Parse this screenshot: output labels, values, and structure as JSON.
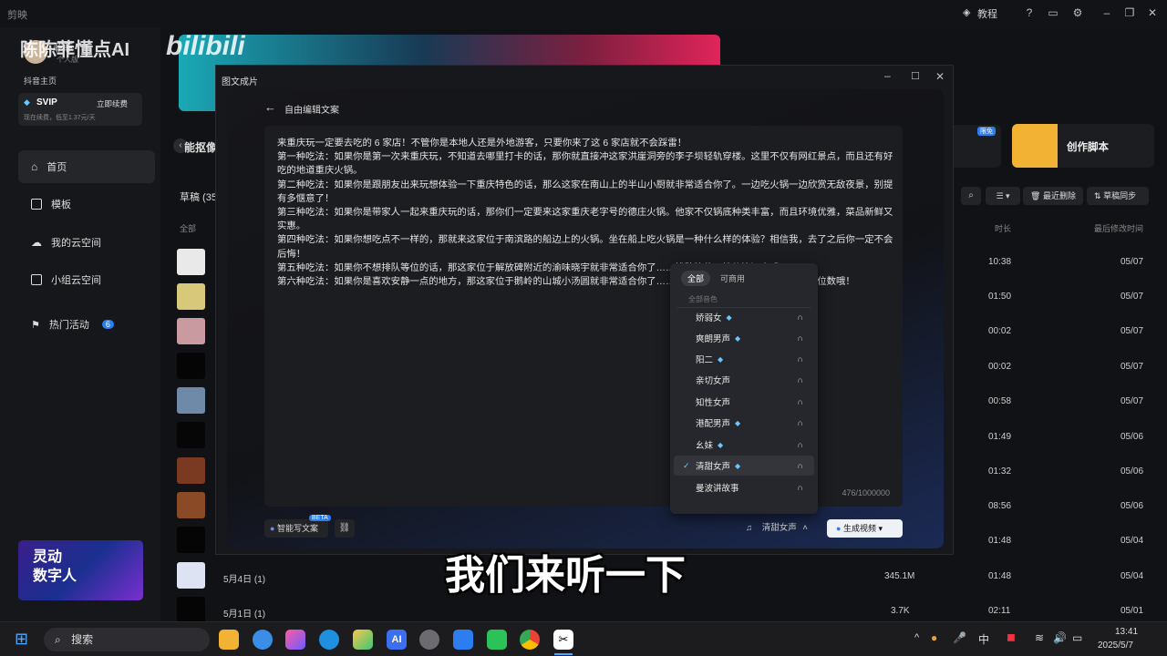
{
  "app": {
    "title": "剪映",
    "tutorial": "教程"
  },
  "watermark": {
    "channel": "陈陈菲懂点AI",
    "brand": "bilibili"
  },
  "profile": {
    "name": "菲菲",
    "sub": "个人版",
    "douyin": "抖音主页",
    "svip": "SVIP",
    "renew": "立即续费",
    "renew_note": "现在续费，低至1.37元/天"
  },
  "sidebar": {
    "items": [
      {
        "label": "首页"
      },
      {
        "label": "模板"
      },
      {
        "label": "我的云空间"
      },
      {
        "label": "小组云空间"
      },
      {
        "label": "热门活动",
        "badge": "6"
      }
    ],
    "promo": "灵动\n数字人"
  },
  "main": {
    "tool_label": "能抠像",
    "drafts_label": "草稿 (35",
    "all_label": "全部",
    "toolbar": {
      "delete": "最近删除",
      "sync": "草稿同步"
    },
    "col_duration": "时长",
    "col_modified": "最后修改时间",
    "free_badge": "限免",
    "script_card": "创作脚本",
    "rows": [
      {
        "duration": "10:38",
        "date": "05/07"
      },
      {
        "duration": "01:50",
        "date": "05/07"
      },
      {
        "duration": "00:02",
        "date": "05/07"
      },
      {
        "duration": "00:02",
        "date": "05/07"
      },
      {
        "duration": "00:58",
        "date": "05/07"
      },
      {
        "duration": "01:49",
        "date": "05/06"
      },
      {
        "duration": "01:32",
        "date": "05/06"
      },
      {
        "duration": "08:56",
        "date": "05/06"
      },
      {
        "duration": "01:48",
        "date": "05/04"
      },
      {
        "name": "5月4日 (1)",
        "size": "345.1M",
        "duration": "01:48",
        "date": "05/04"
      },
      {
        "name": "5月1日 (1)",
        "size": "3.7K",
        "duration": "02:11",
        "date": "05/01"
      }
    ]
  },
  "modal": {
    "title": "图文成片",
    "back_label": "自由编辑文案",
    "paragraphs": [
      "来重庆玩一定要去吃的 6 家店！不管你是本地人还是外地游客，只要你来了这 6 家店就不会踩雷！",
      "第一种吃法：如果你是第一次来重庆玩，不知道去哪里打卡的话，那你就直接冲这家洪崖洞旁的李子坝轻轨穿楼。这里不仅有网红景点，而且还有好吃的地道重庆火锅。",
      "第二种吃法：如果你是跟朋友出来玩想体验一下重庆特色的话，那么这家在南山上的半山小厨就非常适合你了。一边吃火锅一边欣赏无敌夜景，别提有多惬意了！",
      "第三种吃法：如果你是带家人一起来重庆玩的话，那你们一定要来这家重庆老字号的德庄火锅。他家不仅锅底种类丰富，而且环境优雅，菜品新鲜又实惠。",
      "第四种吃法：如果你想吃点不一样的，那就来这家位于南滨路的船边上的火锅。坐在船上吃火锅是一种什么样的体验？相信我，去了之后你一定不会后悔！",
      "第五种吃法：如果你不想排队等位的话，那这家位于解放碑附近的渝味晓宇就非常适合你了……排队等位，性价比还高哦！",
      "第六种吃法：如果你是喜欢安静一点的地方，那这家位于鹅岭的山城小汤圆就非常适合你了……真的超级棒，关键是人均消费才三位数哦！"
    ],
    "char_count": "476/1000000",
    "ai_write": "智能写文案",
    "beta": "BETA",
    "voice_selected": "清甜女声",
    "generate": "生成视频"
  },
  "voice_dropdown": {
    "tabs": [
      "全部",
      "可商用"
    ],
    "section": "全部音色",
    "items": [
      {
        "label": "娇弱女",
        "vip": true
      },
      {
        "label": "爽朗男声",
        "vip": true
      },
      {
        "label": "阳二",
        "vip": true
      },
      {
        "label": "亲切女声",
        "vip": false
      },
      {
        "label": "知性女声",
        "vip": false
      },
      {
        "label": "港配男声",
        "vip": true
      },
      {
        "label": "幺妹",
        "vip": true
      },
      {
        "label": "清甜女声",
        "vip": true,
        "selected": true
      },
      {
        "label": "曼波讲故事",
        "vip": false
      }
    ]
  },
  "subtitle": "我们来听一下",
  "taskbar": {
    "search": "搜索",
    "ime": "中",
    "time": "13:41",
    "date": "2025/5/7"
  },
  "colors": {
    "accent": "#2b7df0",
    "gold": "#f2b233",
    "gem": "#6ac6ff"
  }
}
